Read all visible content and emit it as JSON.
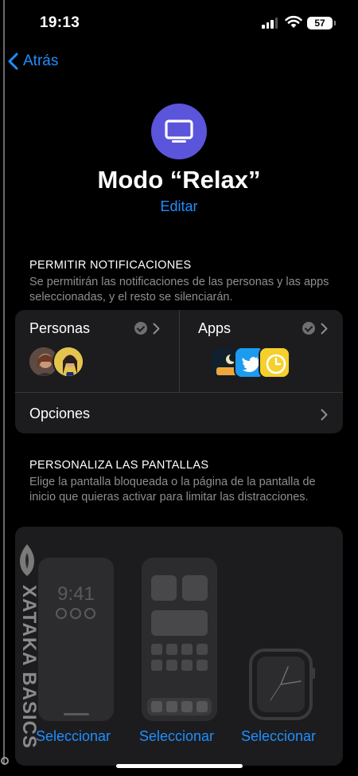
{
  "status": {
    "time": "19:13",
    "battery": "57"
  },
  "nav": {
    "back_label": "Atrás"
  },
  "focus": {
    "title": "Modo “Relax”",
    "edit_label": "Editar",
    "icon": "tv-icon",
    "icon_color": "#5b55dc"
  },
  "allow_section": {
    "header": "PERMITIR NOTIFICACIONES",
    "description": "Se permitirán las notificaciones de las personas y las apps seleccionadas, y el resto se silenciarán.",
    "people_label": "Personas",
    "apps_label": "Apps",
    "options_label": "Opciones",
    "apps": [
      "sleep-icon",
      "twitter-icon",
      "clock-icon"
    ]
  },
  "screens_section": {
    "header": "PERSONALIZA LAS PANTALLAS",
    "description": "Elige la pantalla bloqueada o la página de la pantalla de inicio que quieras activar para limitar las distracciones.",
    "lock_time": "9:41",
    "select_labels": [
      "Seleccionar",
      "Seleccionar",
      "Seleccionar"
    ]
  },
  "watermark": {
    "text": "XATAKA BASICS"
  },
  "colors": {
    "accent": "#1f8fff",
    "card": "#1c1c1e",
    "secondary_text": "#8e8e93"
  }
}
